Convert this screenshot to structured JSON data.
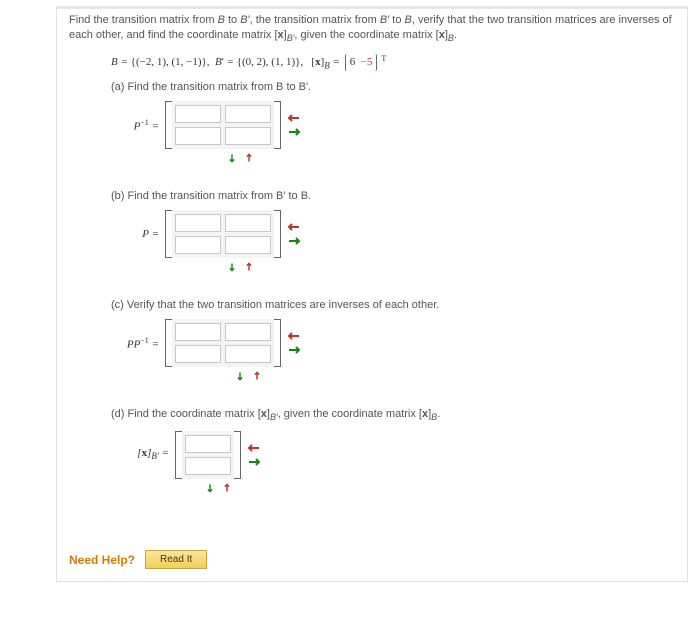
{
  "intro": "Find the transition matrix from B to B′, the transition matrix from B′ to B, verify that the two transition matrices are inverses of each other, and find the coordinate matrix [x]_B′, given the coordinate matrix [x]_B.",
  "given": {
    "B_text": "B = {(-2, 1), (1, -1)},",
    "Bprime_text": "B′ = {(0, 2), (1, 1)},",
    "xB_label": "[x]_B =",
    "xB_vals": [
      "6",
      "−5"
    ],
    "transpose": "T"
  },
  "parts": {
    "a": {
      "label": "(a) Find the transition matrix from B to B′.",
      "lhs": "P⁻¹ ="
    },
    "b": {
      "label": "(b) Find the transition matrix from B′ to B.",
      "lhs": "P ="
    },
    "c": {
      "label": "(c) Verify that the two transition matrices are inverses of each other.",
      "lhs": "PP⁻¹ ="
    },
    "d": {
      "label": "(d) Find the coordinate matrix [x]_B′, given the coordinate matrix [x]_B.",
      "lhs": "[x]_B′ ="
    }
  },
  "need_help": {
    "label": "Need Help?",
    "button": "Read It"
  }
}
